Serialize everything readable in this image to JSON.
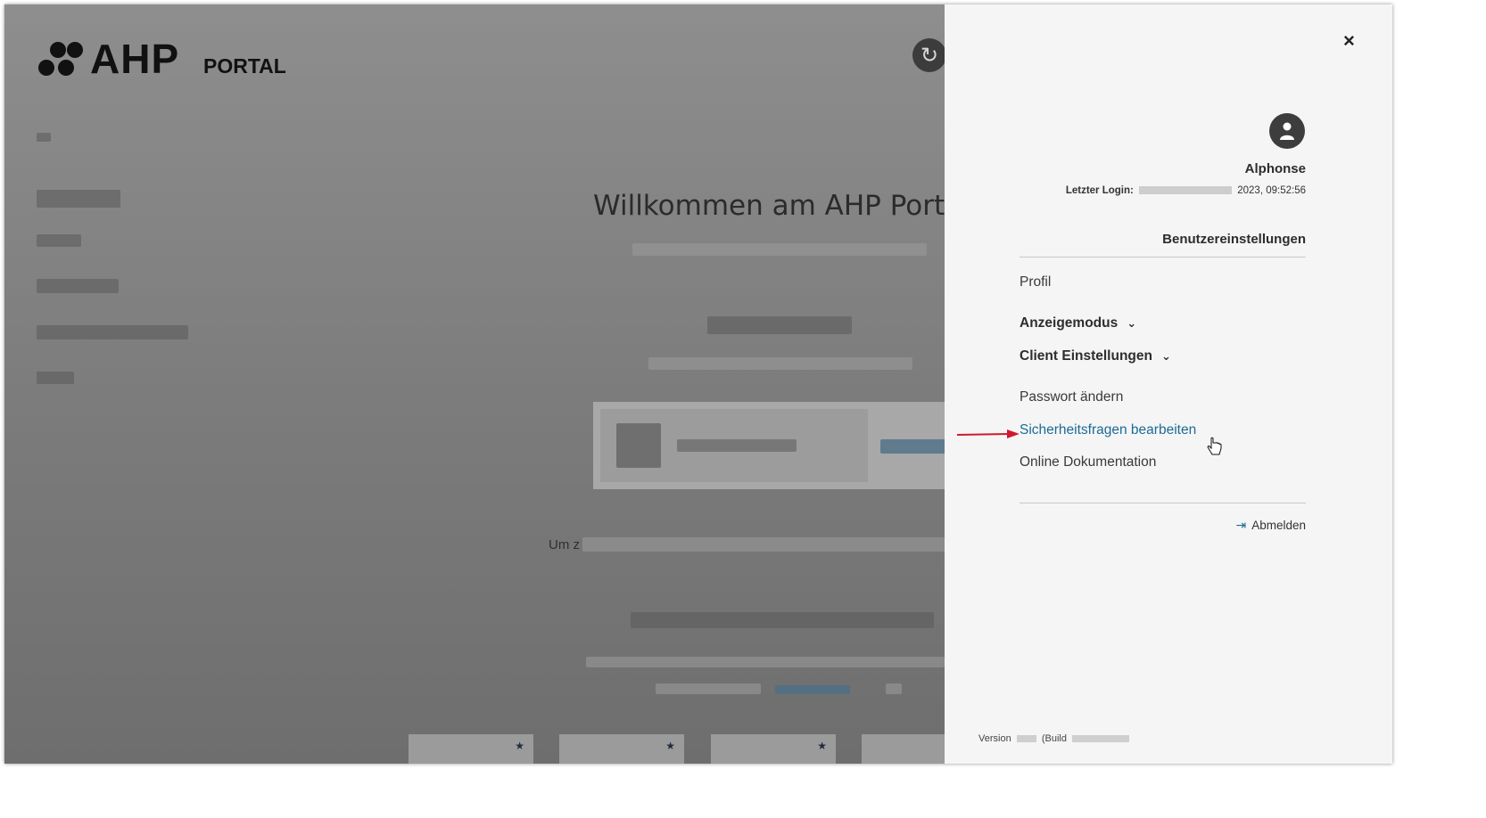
{
  "background": {
    "logo": {
      "brand": "AHP",
      "sub": "PORTAL"
    },
    "welcome_title": "Willkommen am AHP Port",
    "um_text": "Um z",
    "refresh_icon": "refresh-icon",
    "tile_star_icon": "star-icon"
  },
  "drawer": {
    "close_label": "×",
    "user": {
      "name": "Alphonse",
      "last_login_label": "Letzter Login:",
      "last_login_value": "2023, 09:52:56"
    },
    "settings_title": "Benutzereinstellungen",
    "menu": {
      "profil": "Profil",
      "anzeigemodus": "Anzeigemodus",
      "client": "Client Einstellungen",
      "passwort": "Passwort ändern",
      "sicherheitsfragen": "Sicherheitsfragen bearbeiten",
      "dokumentation": "Online Dokumentation"
    },
    "logout": "Abmelden",
    "version_label": "Version",
    "build_label": "(Build"
  },
  "colors": {
    "accent": "#1c6b95",
    "annotation_arrow": "#d0182f",
    "overlay_gray": "#7a7a7a"
  }
}
